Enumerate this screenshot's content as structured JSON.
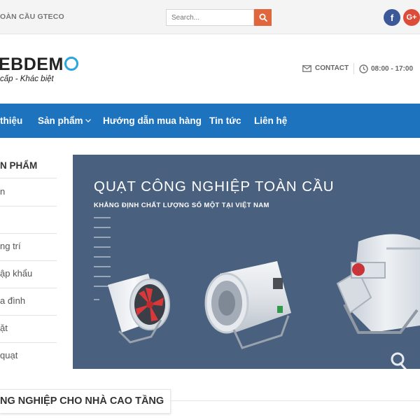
{
  "topbar": {
    "brand": "OÀN CẦU GTECO",
    "search_placeholder": "Search...",
    "social": {
      "facebook": "f",
      "google": "G+"
    }
  },
  "header": {
    "logo_text": "EBDEM",
    "tagline": "cấp - Khác biệt",
    "contact_label": "CONTACT",
    "hours_label": "08:00 - 17:00"
  },
  "nav": {
    "items": [
      "thiệu",
      "Sản phẩm",
      "Hướng dẫn mua hàng",
      "Tin tức",
      "Liên hệ"
    ]
  },
  "sidebar": {
    "title": "N PHẨM",
    "items": [
      "n",
      "",
      "ng trí",
      "ập khẩu",
      "a đình",
      "ặt",
      "quạt"
    ]
  },
  "banner": {
    "title": "QUẠT CÔNG NGHIỆP TOÀN CẦU",
    "subtitle": "KHẲNG ĐỊNH CHẤT LƯỢNG SỐ MỘT TẠI VIỆT NAM"
  },
  "category": {
    "title": "NG NGHIỆP CHO NHÀ CAO TẦNG"
  },
  "colors": {
    "nav_bg": "#1e73be",
    "banner_bg": "#49607f",
    "search_button": "#e0663d",
    "logo_accent": "#29a6de",
    "facebook": "#3b5998",
    "google": "#dd4b39"
  }
}
